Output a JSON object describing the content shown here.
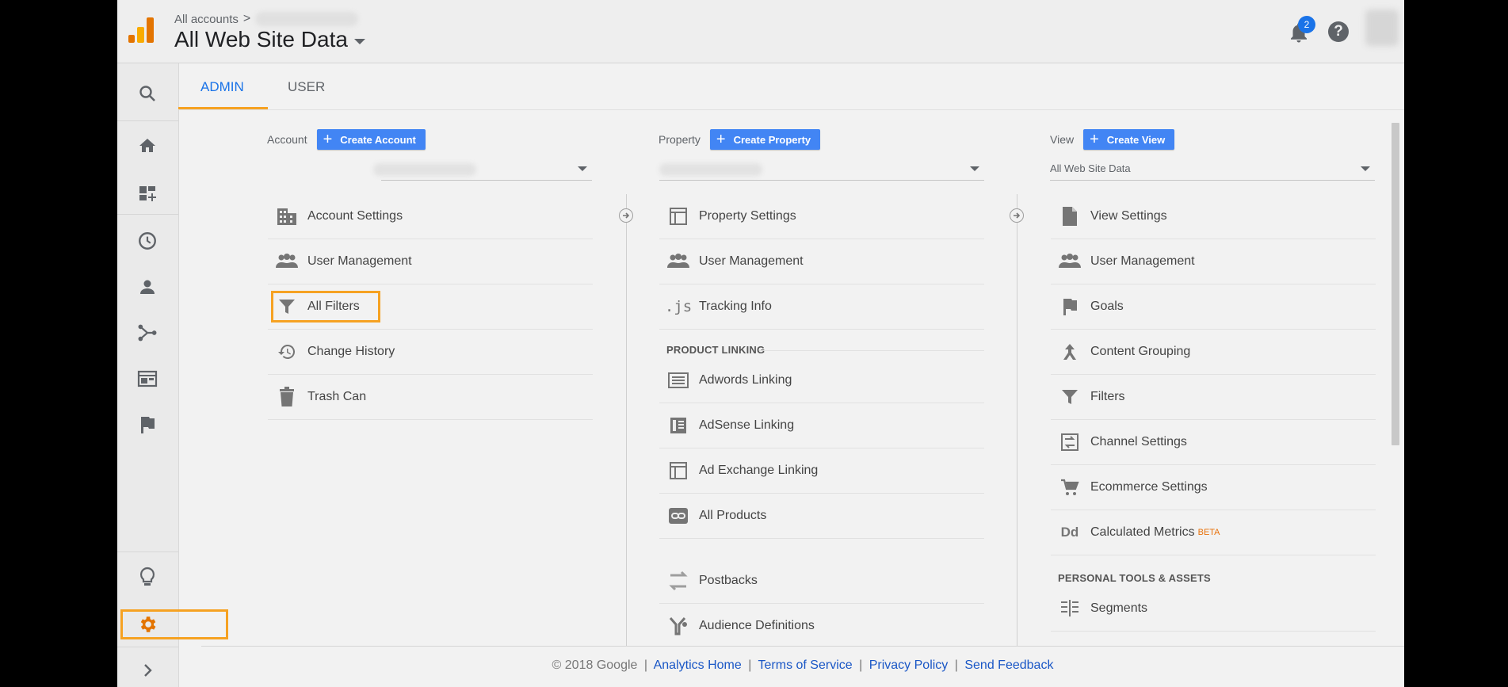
{
  "header": {
    "breadcrumb_root": "All accounts",
    "breadcrumb_sep": ">",
    "view_title": "All Web Site Data",
    "notification_count": "2",
    "help_glyph": "?"
  },
  "tabs": [
    {
      "label": "ADMIN",
      "active": true
    },
    {
      "label": "USER",
      "active": false
    }
  ],
  "account": {
    "label": "Account",
    "create_label": "Create Account",
    "plus": "+",
    "items": [
      {
        "label": "Account Settings",
        "icon": "building-icon"
      },
      {
        "label": "User Management",
        "icon": "people-icon"
      },
      {
        "label": "All Filters",
        "icon": "filter-icon"
      },
      {
        "label": "Change History",
        "icon": "history-icon"
      },
      {
        "label": "Trash Can",
        "icon": "trash-icon"
      }
    ]
  },
  "property": {
    "label": "Property",
    "create_label": "Create Property",
    "plus": "+",
    "items": [
      {
        "label": "Property Settings",
        "icon": "window-icon"
      },
      {
        "label": "User Management",
        "icon": "people-icon"
      },
      {
        "label": "Tracking Info",
        "icon": "js-icon",
        "glyph": ".js"
      }
    ],
    "section_label": "PRODUCT LINKING",
    "linking_items": [
      {
        "label": "Adwords Linking",
        "icon": "adwords-icon"
      },
      {
        "label": "AdSense Linking",
        "icon": "adsense-icon"
      },
      {
        "label": "Ad Exchange Linking",
        "icon": "adexchange-icon"
      },
      {
        "label": "All Products",
        "icon": "link-icon"
      },
      {
        "label": "Postbacks",
        "icon": "postbacks-icon"
      },
      {
        "label": "Audience Definitions",
        "icon": "audience-icon"
      }
    ]
  },
  "view": {
    "label": "View",
    "create_label": "Create View",
    "plus": "+",
    "selected": "All Web Site Data",
    "items": [
      {
        "label": "View Settings",
        "icon": "document-icon"
      },
      {
        "label": "User Management",
        "icon": "people-icon"
      },
      {
        "label": "Goals",
        "icon": "flag-icon"
      },
      {
        "label": "Content Grouping",
        "icon": "content-grouping-icon"
      },
      {
        "label": "Filters",
        "icon": "filter-icon"
      },
      {
        "label": "Channel Settings",
        "icon": "channel-icon"
      },
      {
        "label": "Ecommerce Settings",
        "icon": "cart-icon"
      },
      {
        "label": "Calculated Metrics",
        "icon": "dd-icon",
        "glyph": "Dd",
        "badge": "BETA"
      }
    ],
    "section_label": "PERSONAL TOOLS & ASSETS",
    "tools_items": [
      {
        "label": "Segments",
        "icon": "segments-icon"
      }
    ]
  },
  "footer": {
    "copyright": "© 2018 Google",
    "links": [
      "Analytics Home",
      "Terms of Service",
      "Privacy Policy",
      "Send Feedback"
    ],
    "sep": "|"
  },
  "colors": {
    "accent_blue": "#4285f4",
    "highlight_orange": "#f6a222",
    "link_blue": "#1a57c6",
    "beta_orange": "#e8710a"
  }
}
